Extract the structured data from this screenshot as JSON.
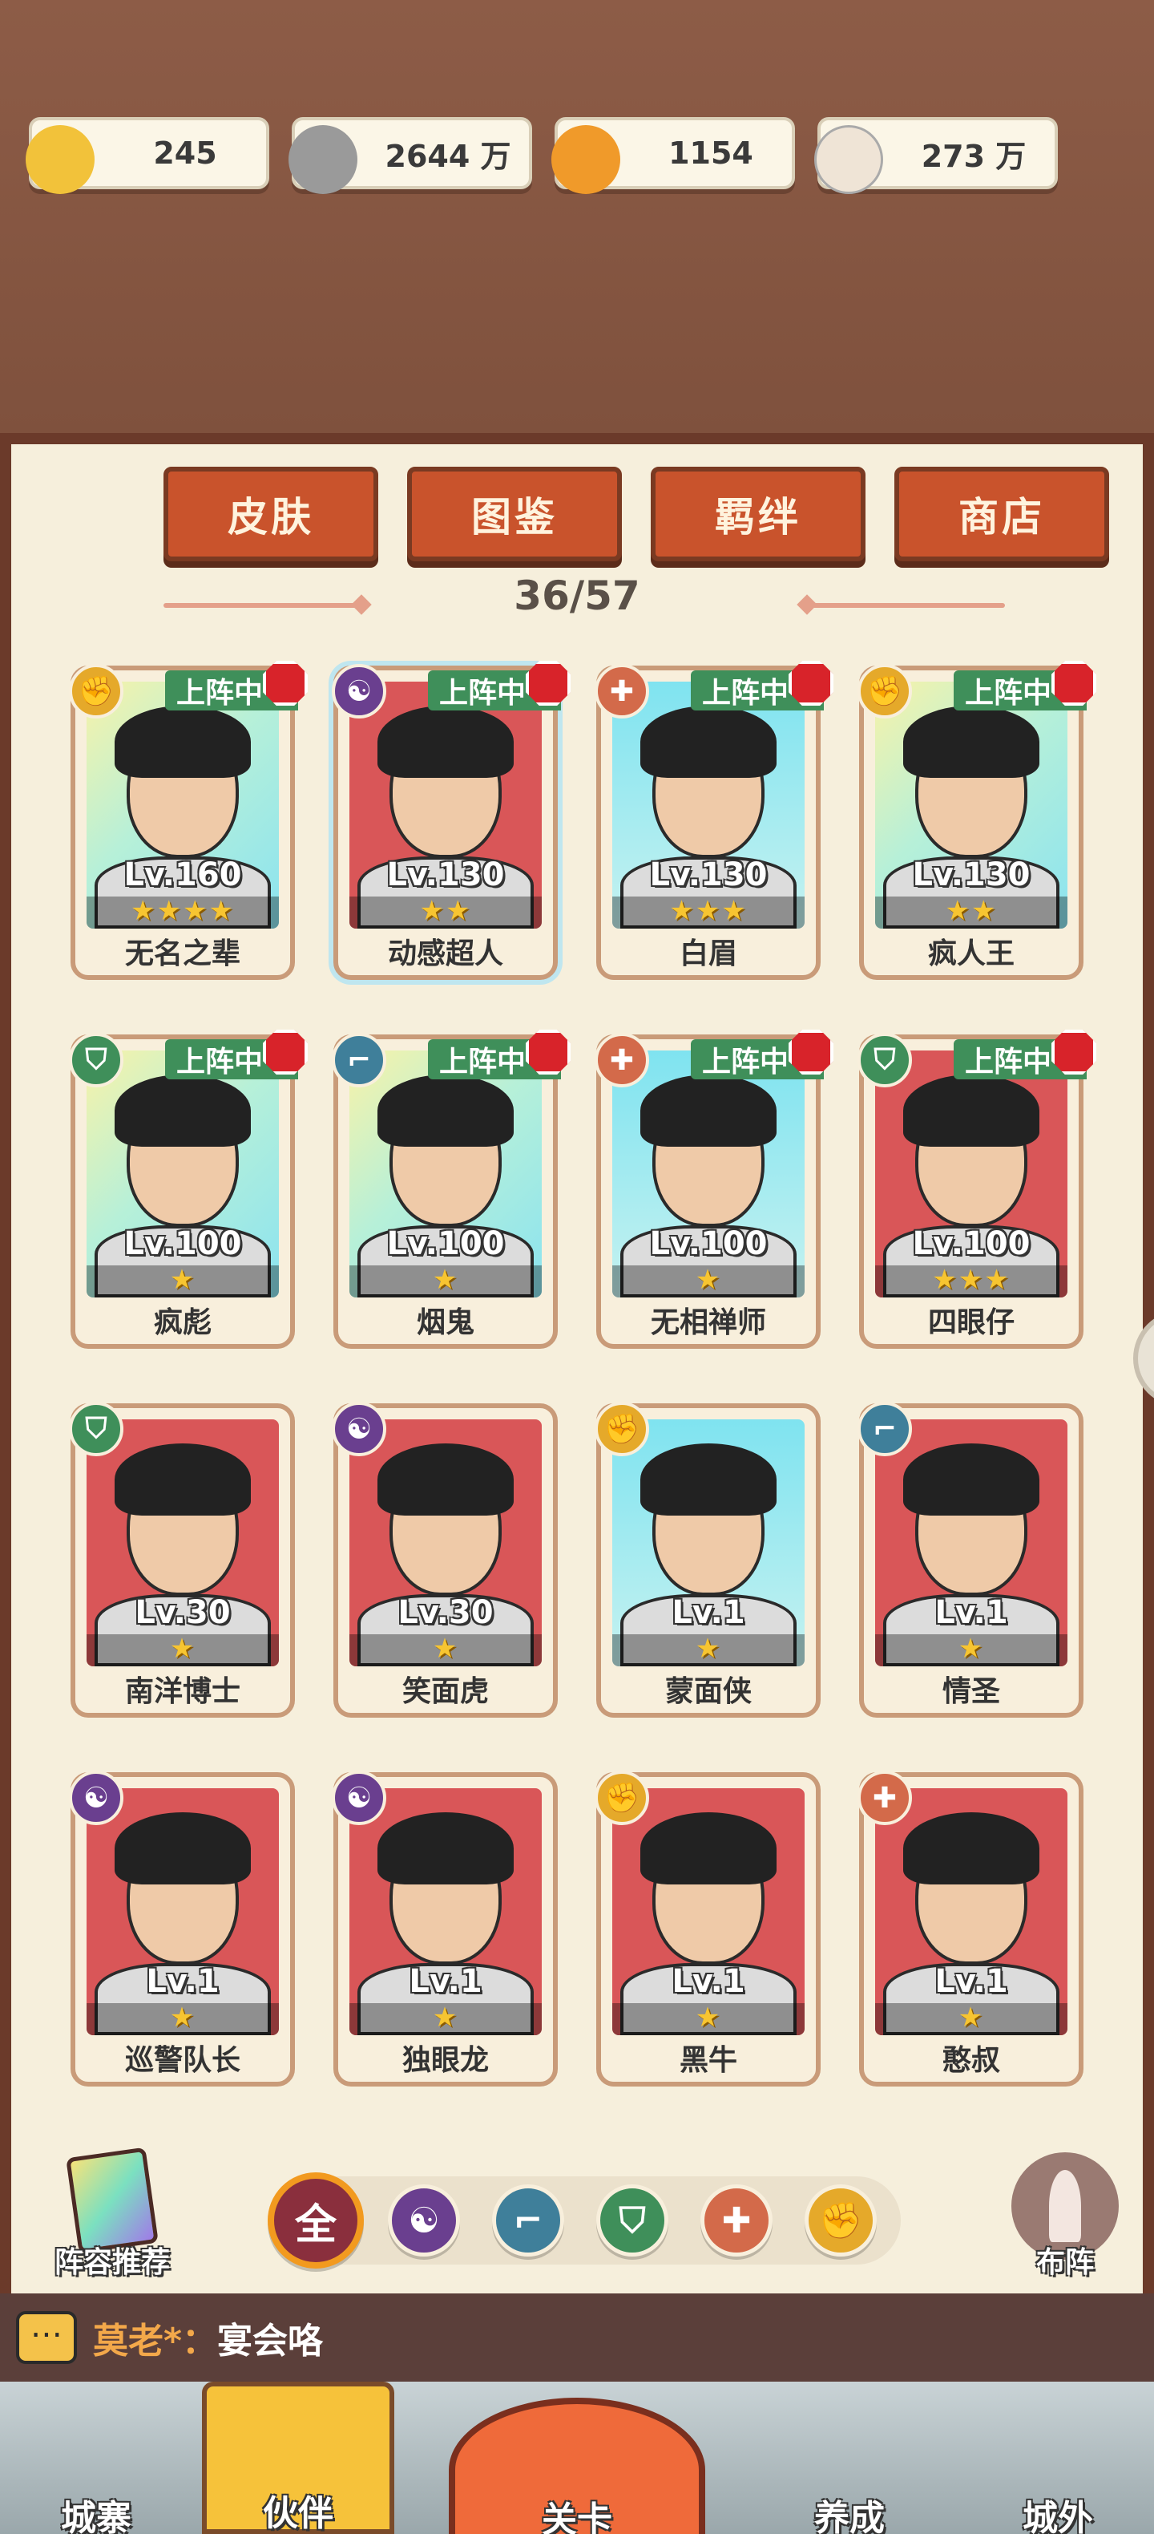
{
  "resources": [
    {
      "name": "gold-ingot",
      "value": "245",
      "icon_color": "#f2c23a"
    },
    {
      "name": "silver-coin",
      "value": "2644 万",
      "icon_color": "#9a9a9a"
    },
    {
      "name": "roast-chicken",
      "value": "1154",
      "icon_color": "#f09a2a"
    },
    {
      "name": "exp-dumpling",
      "value": "273 万",
      "icon_color": "#efe4d6"
    }
  ],
  "tabs": [
    {
      "label": "皮肤"
    },
    {
      "label": "图鉴"
    },
    {
      "label": "羁绊"
    },
    {
      "label": "商店"
    }
  ],
  "collection_count": "36/57",
  "deployed_label": "上阵中",
  "heroes": [
    {
      "name": "无名之辈",
      "level": "Lv.160",
      "stars": "★★★★",
      "class": "fist",
      "deployed": true,
      "bg": "rainbow"
    },
    {
      "name": "动感超人",
      "level": "Lv.130",
      "stars": "★★",
      "class": "yinyang",
      "deployed": true,
      "bg": "red",
      "selected": true
    },
    {
      "name": "白眉",
      "level": "Lv.130",
      "stars": "★★★",
      "class": "cross",
      "deployed": true,
      "bg": "cyan"
    },
    {
      "name": "疯人王",
      "level": "Lv.130",
      "stars": "★★",
      "class": "fist",
      "deployed": true,
      "bg": "rainbow"
    },
    {
      "name": "疯彪",
      "level": "Lv.100",
      "stars": "★",
      "class": "shield",
      "deployed": true,
      "bg": "rainbow"
    },
    {
      "name": "烟鬼",
      "level": "Lv.100",
      "stars": "★",
      "class": "gun",
      "deployed": true,
      "bg": "rainbow"
    },
    {
      "name": "无相禅师",
      "level": "Lv.100",
      "stars": "★",
      "class": "cross",
      "deployed": true,
      "bg": "cyan"
    },
    {
      "name": "四眼仔",
      "level": "Lv.100",
      "stars": "★★★",
      "class": "shield",
      "deployed": true,
      "bg": "red"
    },
    {
      "name": "南洋博士",
      "level": "Lv.30",
      "stars": "★",
      "class": "shield",
      "deployed": false,
      "bg": "red"
    },
    {
      "name": "笑面虎",
      "level": "Lv.30",
      "stars": "★",
      "class": "yinyang",
      "deployed": false,
      "bg": "red"
    },
    {
      "name": "蒙面侠",
      "level": "Lv.1",
      "stars": "★",
      "class": "fist",
      "deployed": false,
      "bg": "cyan"
    },
    {
      "name": "情圣",
      "level": "Lv.1",
      "stars": "★",
      "class": "gun",
      "deployed": false,
      "bg": "red"
    },
    {
      "name": "巡警队长",
      "level": "Lv.1",
      "stars": "★",
      "class": "yinyang",
      "deployed": false,
      "bg": "red"
    },
    {
      "name": "独眼龙",
      "level": "Lv.1",
      "stars": "★",
      "class": "yinyang",
      "deployed": false,
      "bg": "red"
    },
    {
      "name": "黑牛",
      "level": "Lv.1",
      "stars": "★",
      "class": "fist",
      "deployed": false,
      "bg": "red"
    },
    {
      "name": "憨叔",
      "level": "Lv.1",
      "stars": "★",
      "class": "cross",
      "deployed": false,
      "bg": "red"
    }
  ],
  "bottom": {
    "recommend_label": "阵容推荐",
    "deploy_label": "布阵",
    "filters": [
      {
        "name": "all",
        "label": "全",
        "active": true
      },
      {
        "name": "yinyang",
        "label": "☯",
        "color": "#6a3f8f"
      },
      {
        "name": "gun",
        "label": "⌐",
        "color": "#3f7f9a"
      },
      {
        "name": "shield",
        "label": "⛉",
        "color": "#3f8f5a"
      },
      {
        "name": "cross",
        "label": "✚",
        "color": "#d36a4a"
      },
      {
        "name": "fist",
        "label": "✊",
        "color": "#e5a92a"
      }
    ]
  },
  "chat": {
    "user": "莫老*：",
    "message": "宴会咯"
  },
  "nav": [
    {
      "name": "city",
      "label": "城寨"
    },
    {
      "name": "partners",
      "label": "伙伴",
      "active": true
    },
    {
      "name": "stage",
      "label": "关卡"
    },
    {
      "name": "train",
      "label": "养成"
    },
    {
      "name": "outside",
      "label": "城外"
    }
  ]
}
